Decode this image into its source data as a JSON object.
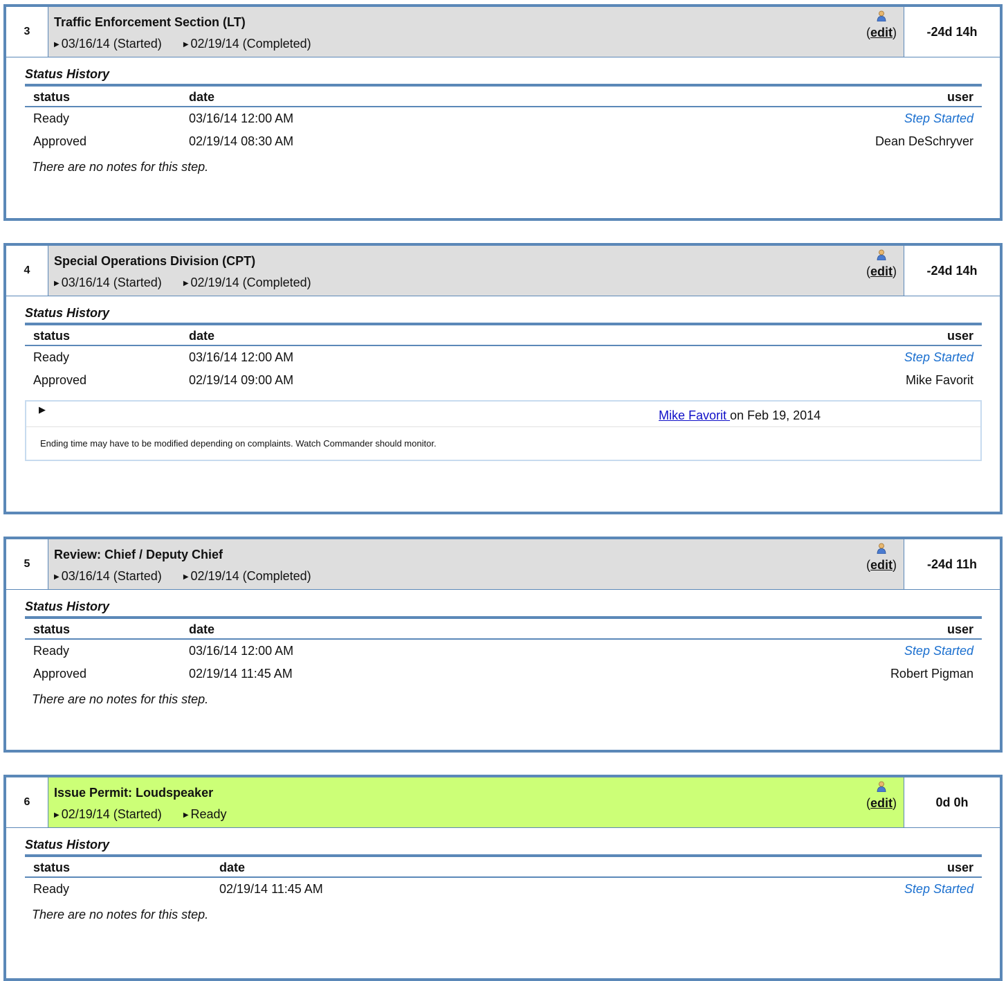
{
  "edit_label": "edit",
  "status_history_label": "Status History",
  "headers": {
    "status": "status",
    "date": "date",
    "user": "user"
  },
  "steps": [
    {
      "number": "3",
      "title": "Traffic Enforcement Section (LT)",
      "started": "03/16/14 (Started)",
      "completed": "02/19/14 (Completed)",
      "duration": "-24d 14h",
      "history": [
        {
          "status": "Ready",
          "date": "03/16/14 12:00 AM",
          "user": "Step Started"
        },
        {
          "status": "Approved",
          "date": "02/19/14 08:30 AM",
          "user": "Dean DeSchryver"
        }
      ],
      "notes_text": "There are no notes for this step."
    },
    {
      "number": "4",
      "title": "Special Operations Division (CPT)",
      "started": "03/16/14 (Started)",
      "completed": "02/19/14 (Completed)",
      "duration": "-24d 14h",
      "history": [
        {
          "status": "Ready",
          "date": "03/16/14 12:00 AM",
          "user": "Step Started"
        },
        {
          "status": "Approved",
          "date": "02/19/14 09:00 AM",
          "user": "Mike Favorit"
        }
      ],
      "note": {
        "author": "Mike Favorit ",
        "date": "on Feb 19, 2014",
        "text": "Ending time may have to be modified depending on complaints. Watch Commander should monitor."
      }
    },
    {
      "number": "5",
      "title": "Review: Chief / Deputy Chief",
      "started": "03/16/14 (Started)",
      "completed": "02/19/14 (Completed)",
      "duration": "-24d 11h",
      "history": [
        {
          "status": "Ready",
          "date": "03/16/14 12:00 AM",
          "user": "Step Started"
        },
        {
          "status": "Approved",
          "date": "02/19/14 11:45 AM",
          "user": "Robert Pigman"
        }
      ],
      "notes_text": "There are no notes for this step."
    },
    {
      "number": "6",
      "title": "Issue Permit: Loudspeaker",
      "started": "02/19/14 (Started)",
      "completed": "Ready",
      "duration": "0d 0h",
      "history": [
        {
          "status": "Ready",
          "date": "02/19/14 11:45 AM",
          "user": "Step Started"
        }
      ],
      "notes_text": "There are no notes for this step."
    }
  ]
}
